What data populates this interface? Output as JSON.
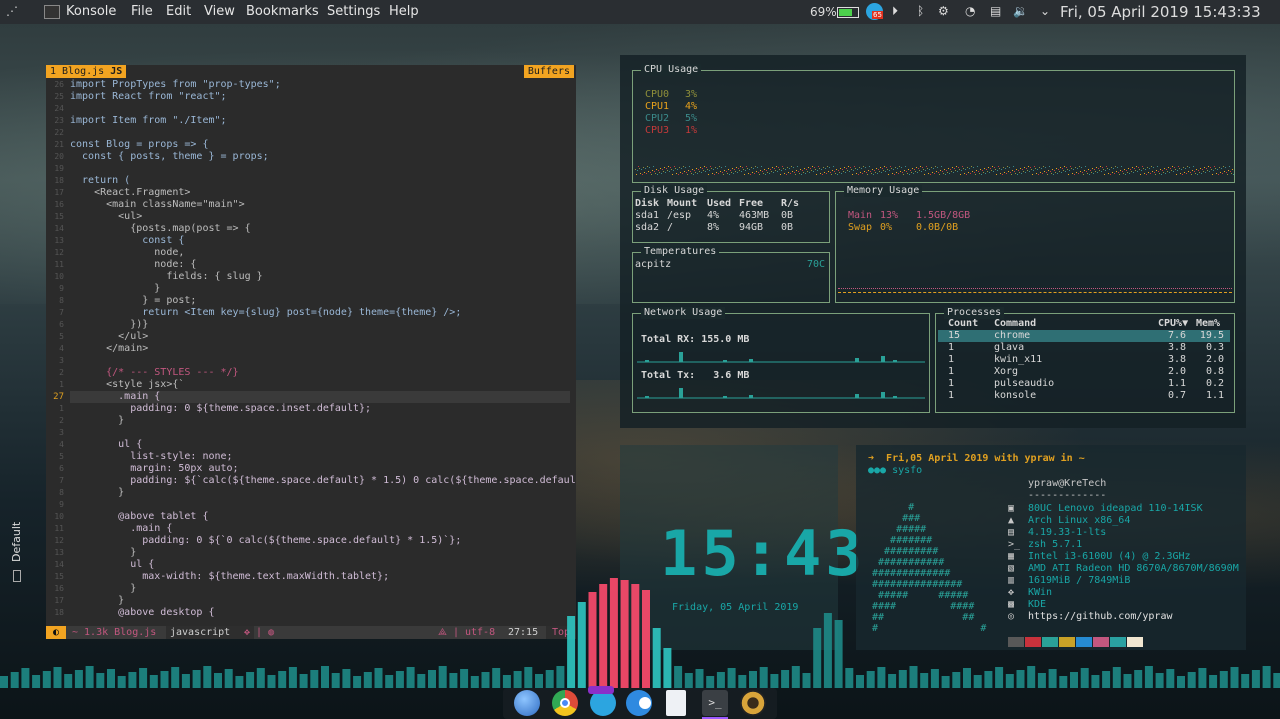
{
  "topbar": {
    "app_name": "Konsole",
    "menus": [
      "File",
      "Edit",
      "View",
      "Bookmarks",
      "Settings",
      "Help"
    ],
    "battery": "69%",
    "notification_badge": "65",
    "datetime": "Fri, 05 April 2019 15:43:33",
    "icons": [
      "kde-menu-icon",
      "konsole-icon",
      "battery-icon",
      "telegram-icon",
      "media-play-icon",
      "bluetooth-icon",
      "steam-icon",
      "wifi-icon",
      "clipboard-icon",
      "volume-icon",
      "chevron-down-icon"
    ]
  },
  "side_tab": {
    "label": "Default"
  },
  "editor": {
    "tab": "1 Blog.js",
    "tab_lang": "JS",
    "buffers_label": "Buffers",
    "lines": [
      {
        "n": "26",
        "code": "import PropTypes from \"prop-types\";"
      },
      {
        "n": "25",
        "code": "import React from \"react\";"
      },
      {
        "n": "24",
        "code": ""
      },
      {
        "n": "23",
        "code": "import Item from \"./Item\";"
      },
      {
        "n": "22",
        "code": ""
      },
      {
        "n": "21",
        "code": "const Blog = props => {"
      },
      {
        "n": "20",
        "code": "  const { posts, theme } = props;"
      },
      {
        "n": "19",
        "code": ""
      },
      {
        "n": "18",
        "code": "  return ("
      },
      {
        "n": "17",
        "code": "    <React.Fragment>"
      },
      {
        "n": "16",
        "code": "      <main className=\"main\">"
      },
      {
        "n": "15",
        "code": "        <ul>"
      },
      {
        "n": "14",
        "code": "          {posts.map(post => {"
      },
      {
        "n": "13",
        "code": "            const {"
      },
      {
        "n": "12",
        "code": "              node,"
      },
      {
        "n": "11",
        "code": "              node: {"
      },
      {
        "n": "10",
        "code": "                fields: { slug }"
      },
      {
        "n": "9",
        "code": "              }"
      },
      {
        "n": "8",
        "code": "            } = post;"
      },
      {
        "n": "7",
        "code": "            return <Item key={slug} post={node} theme={theme} />;"
      },
      {
        "n": "6",
        "code": "          })}"
      },
      {
        "n": "5",
        "code": "        </ul>"
      },
      {
        "n": "4",
        "code": "      </main>"
      },
      {
        "n": "3",
        "code": ""
      },
      {
        "n": "2",
        "code": "      {/* --- STYLES --- */}"
      },
      {
        "n": "1",
        "code": "      <style jsx>{`"
      },
      {
        "n": "27",
        "code": "        .main {"
      },
      {
        "n": "1",
        "code": "          padding: 0 ${theme.space.inset.default};"
      },
      {
        "n": "2",
        "code": "        }"
      },
      {
        "n": "3",
        "code": ""
      },
      {
        "n": "4",
        "code": "        ul {"
      },
      {
        "n": "5",
        "code": "          list-style: none;"
      },
      {
        "n": "6",
        "code": "          margin: 50px auto;"
      },
      {
        "n": "7",
        "code": "          padding: ${`calc(${theme.space.default} * 1.5) 0 calc(${theme.space.default} * ~"
      },
      {
        "n": "8",
        "code": "        }"
      },
      {
        "n": "9",
        "code": ""
      },
      {
        "n": "10",
        "code": "        @above tablet {"
      },
      {
        "n": "11",
        "code": "          .main {"
      },
      {
        "n": "12",
        "code": "            padding: 0 ${`0 calc(${theme.space.default} * 1.5)`};"
      },
      {
        "n": "13",
        "code": "          }"
      },
      {
        "n": "14",
        "code": "          ul {"
      },
      {
        "n": "15",
        "code": "            max-width: ${theme.text.maxWidth.tablet};"
      },
      {
        "n": "16",
        "code": "          }"
      },
      {
        "n": "17",
        "code": "        }"
      },
      {
        "n": "18",
        "code": "        @above desktop {"
      }
    ],
    "status": {
      "file": "~ 1.3k Blog.js",
      "mode": "javascript",
      "encoding": "⟁ | utf-8",
      "position": "27:15",
      "scroll": "Top"
    }
  },
  "dash": {
    "cpu": {
      "title": "CPU Usage",
      "rows": [
        {
          "name": "CPU0",
          "val": "3%",
          "color": "#8f8f3a"
        },
        {
          "name": "CPU1",
          "val": "4%",
          "color": "#e8a21c"
        },
        {
          "name": "CPU2",
          "val": "5%",
          "color": "#3b8a8a"
        },
        {
          "name": "CPU3",
          "val": "1%",
          "color": "#c53a3a"
        }
      ]
    },
    "disk": {
      "title": "Disk Usage",
      "header": [
        "Disk",
        "Mount",
        "Used",
        "Free",
        "R/s"
      ],
      "rows": [
        [
          "sda1",
          "/esp",
          "4%",
          "463MB",
          "0B"
        ],
        [
          "sda2",
          "/",
          "8%",
          "94GB",
          "0B"
        ]
      ]
    },
    "memory": {
      "title": "Memory Usage",
      "rows": [
        {
          "name": "Main",
          "pct": "13%",
          "val": "1.5GB/8GB",
          "color": "#c2577f"
        },
        {
          "name": "Swap",
          "pct": "0%",
          "val": "0.0B/0B",
          "color": "#e0a020"
        }
      ]
    },
    "temps": {
      "title": "Temperatures",
      "sensor": "acpitz",
      "value": "70C"
    },
    "network": {
      "title": "Network Usage",
      "rx": "Total RX: 155.0 MB",
      "tx": "Total Tx:   3.6 MB"
    },
    "processes": {
      "title": "Processes",
      "header": [
        "Count",
        "Command",
        "CPU%▼",
        "Mem%"
      ],
      "rows": [
        [
          "15",
          "chrome",
          "7.6",
          "19.5"
        ],
        [
          "1",
          "glava",
          "3.8",
          "0.3"
        ],
        [
          "1",
          "kwin_x11",
          "3.8",
          "2.0"
        ],
        [
          "1",
          "Xorg",
          "2.0",
          "0.8"
        ],
        [
          "1",
          "pulseaudio",
          "1.1",
          "0.2"
        ],
        [
          "1",
          "konsole",
          "0.7",
          "1.1"
        ]
      ]
    }
  },
  "clock": {
    "time": "15:43",
    "date": "Friday, 05 April 2019"
  },
  "neofetch": {
    "prompt1": "➜  Fri,05 April 2019 with ypraw in ~",
    "prompt2": "●●● sysfo",
    "userhost": "ypraw@KreTech",
    "sep": "-------------",
    "info": [
      "80UC Lenovo ideapad 110-14ISK",
      "Arch Linux x86_64",
      "4.19.33-1-lts",
      "zsh 5.7.1",
      "Intel i3-6100U (4) @ 2.3GHz",
      "AMD ATI Radeon HD 8670A/8670M/8690M",
      "1619MiB / 7849MiB",
      "KWin",
      "KDE",
      "https://github.com/ypraw"
    ],
    "ascii": [
      "      #",
      "     ###",
      "    #####",
      "   #######",
      "  #########",
      " ###########",
      "#############",
      "###############",
      " #####     #####",
      "####         ####",
      "##             ##",
      "#                 #"
    ],
    "swatches": [
      "#585858",
      "#c8323c",
      "#2aa198",
      "#c9a227",
      "#268bd2",
      "#c2577f",
      "#2aa1a1",
      "#f0e6d0"
    ]
  },
  "dock": {
    "icons": [
      "finder-icon",
      "chrome-icon",
      "telegram-icon",
      "toggle-icon",
      "text-editor-icon",
      "terminal-icon",
      "music-icon"
    ]
  }
}
